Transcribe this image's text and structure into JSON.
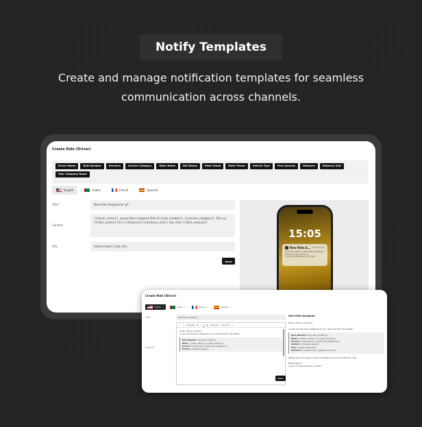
{
  "header": {
    "badge": "Notify Templates",
    "subtitle": "Create and manage notification templates for seamless communication across channels."
  },
  "main_card": {
    "title": "Create Ride (Driver)",
    "tags": [
      "Driver Name",
      "Ride Number",
      "Services",
      "Service Category",
      "Rider Name",
      "Bid Status",
      "Rider Email",
      "Rider Phone",
      "Vehicle Type",
      "Fare Amount",
      "Distance",
      "Distance Unit",
      "Your Company Name"
    ],
    "languages": [
      {
        "label": "English",
        "flag": "us-flag-icon"
      },
      {
        "label": "Arabic",
        "flag": "ar-flag-icon"
      },
      {
        "label": "French",
        "flag": "fr-flag-icon"
      },
      {
        "label": "Spanish",
        "flag": "es-flag-icon"
      }
    ],
    "title_label": "Title*",
    "title_value": "New Ride Assignment 🚀—",
    "content_label": "Content",
    "content_value": "{{driver_name}}, youve been assigned Ride #{{ride_number}} {{service_category}}. Pick up {{rider_name}} for a {{distance}}{{distance_unit}} trip. Fare: {{fare_amount}}",
    "url_label": "URL",
    "url_value": "/driver/rides/{{ride_id}}",
    "save_label": "Save",
    "phone": {
      "time": "15:05",
      "notif_title": "New Ride A...",
      "notif_time": "5 Minutes Ago",
      "notif_body": "{{driver_name}}, Youve Been Assigned Ride #{{ride_number}} {{service_category}}. Pick Up..."
    }
  },
  "second_card": {
    "title": "Create Ride (Driver)",
    "languages": [
      "English",
      "Arabic",
      "French",
      "Spanish"
    ],
    "close_mark": "⊗",
    "title_label": "Title*",
    "title_value": "New Ride Assigned",
    "content_label": "Content",
    "toolbar": {
      "paragraph": "Paragraph",
      "font": "Sans-serif",
      "undo": "↶",
      "redo": "↷",
      "bold": "B",
      "italic": "I",
      "underline": "U",
      "strike": "S",
      "color": "A"
    },
    "editor_lines": [
      "Hello {{driver_name}},",
      "A new ride has been assigned to you. Here are the ride details:"
    ],
    "editor_details": [
      {
        "k": "Ride Number:",
        "v": "#{{ride_number}}"
      },
      {
        "k": "Rider:",
        "v": "{{rider_name}} ({{rider_phone}})"
      },
      {
        "k": "Service:",
        "v": "{{services}} ({{service_category}})"
      },
      {
        "k": "Vehicle:",
        "v": "{{vehicle_type}}"
      }
    ],
    "save_label": "Save",
    "preview": {
      "heading": "New Ride Assigned",
      "greeting": "Hello {{driver_name}},",
      "intro": "A new ride has been assigned to you. Here are the ride details:",
      "details": [
        {
          "k": "Ride Number:",
          "v": "#{{ride_number}}"
        },
        {
          "k": "Rider:",
          "v": "{{rider_name}} ({{rider_phone}})"
        },
        {
          "k": "Service:",
          "v": "{{services}} ({{service_category}})"
        },
        {
          "k": "Vehicle:",
          "v": "{{vehicle_type}}"
        },
        {
          "k": "Fare:",
          "v": "{{fare_amount}}"
        },
        {
          "k": "Distance:",
          "v": "{{distance}} {{distance_unit}}"
        }
      ],
      "outro": "Please open the app to view full details and proceed with the ride.",
      "regards": "Best regards,",
      "team": "{{Your Company Name}} Team"
    }
  }
}
